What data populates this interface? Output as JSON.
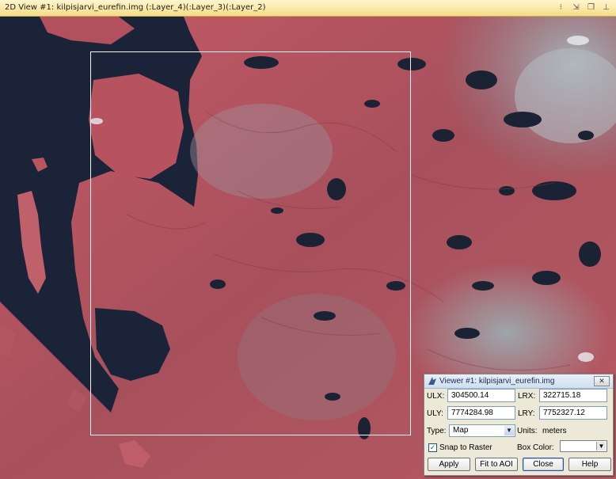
{
  "window": {
    "title": "2D View #1: kilpisjarvi_eurefin.img (:Layer_4)(:Layer_3)(:Layer_2)"
  },
  "toolbar_icons": [
    "pin-icon",
    "arrows-icon",
    "pages-icon",
    "pushpin-icon"
  ],
  "colors": {
    "water": "#1a2338",
    "land_red": "#b9545f",
    "land_gray": "#8f9aa0",
    "title_bar": "#f7e7a3",
    "dialog_bg": "#ece9d8"
  },
  "dialog": {
    "title": "Viewer #1: kilpisjarvi_eurefin.img",
    "ulx_label": "ULX:",
    "ulx_value": "304500.14",
    "lrx_label": "LRX:",
    "lrx_value": "322715.18",
    "uly_label": "ULY:",
    "uly_value": "7774284.98",
    "lry_label": "LRY:",
    "lry_value": "7752327.12",
    "type_label": "Type:",
    "type_value": "Map",
    "units_label": "Units:",
    "units_value": "meters",
    "snap_label": "Snap to Raster",
    "snap_checked": true,
    "box_color_label": "Box Color:",
    "buttons": {
      "apply": "Apply",
      "fit": "Fit to AOI",
      "close": "Close",
      "help": "Help"
    }
  }
}
